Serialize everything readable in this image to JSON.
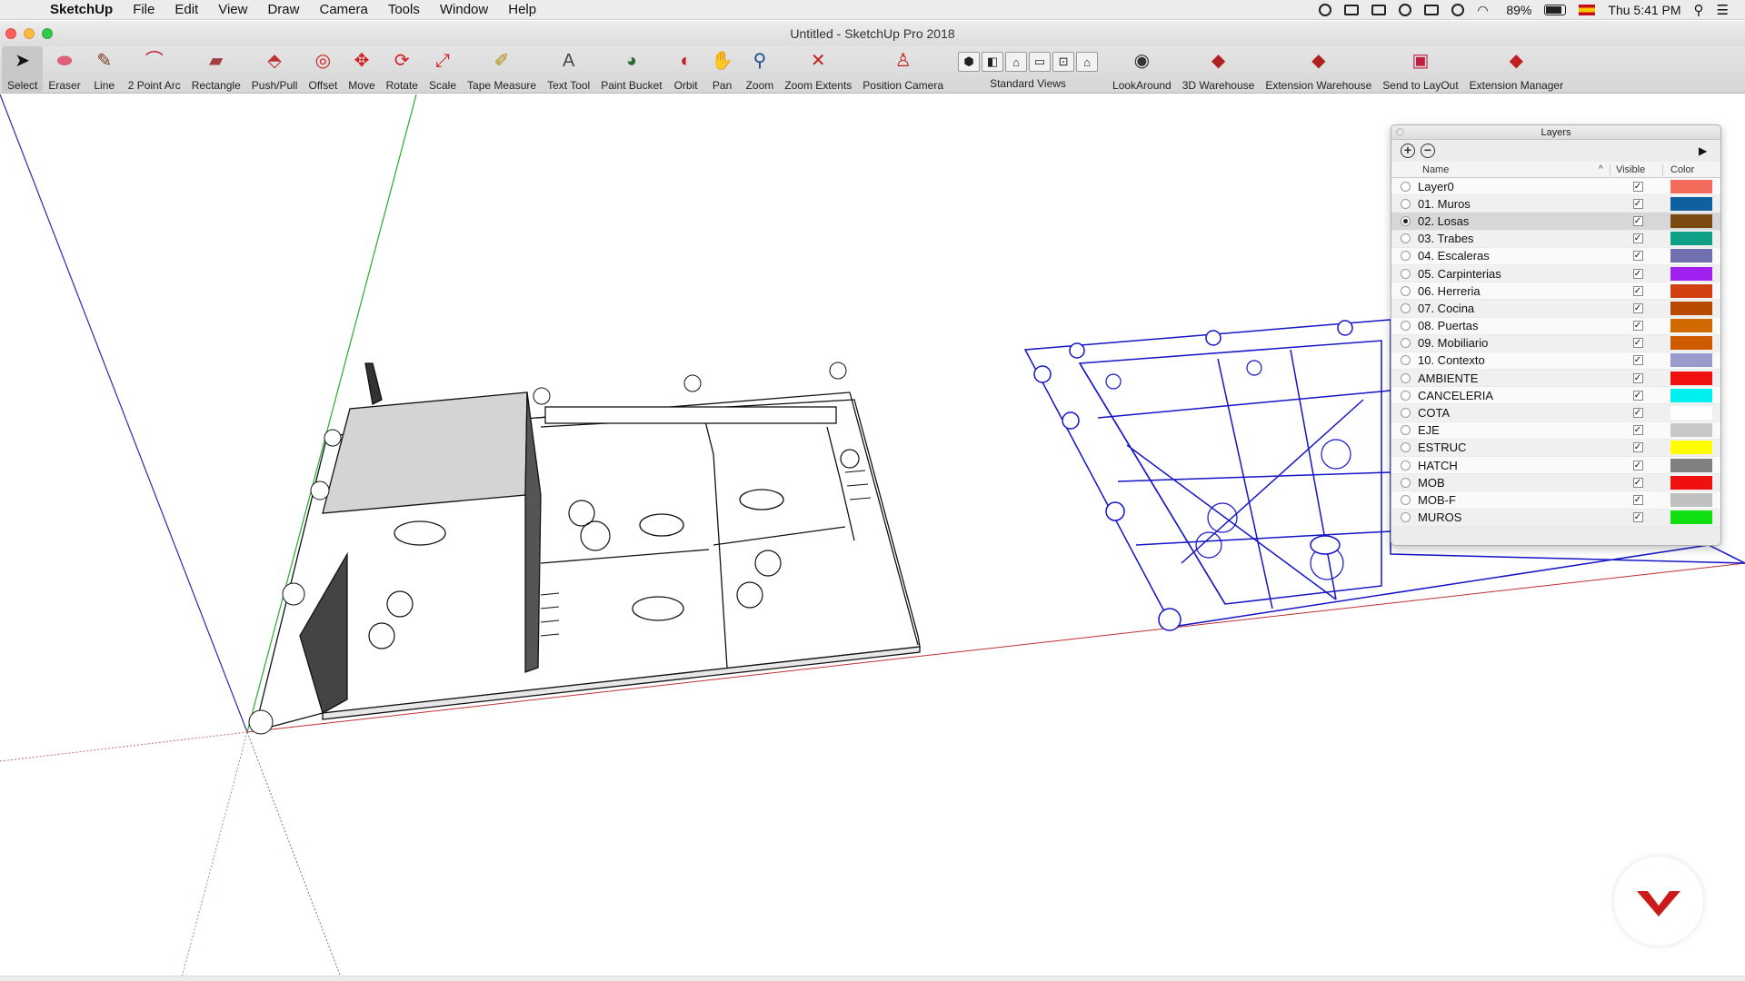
{
  "menubar": {
    "items": [
      "SketchUp",
      "File",
      "Edit",
      "View",
      "Draw",
      "Camera",
      "Tools",
      "Window",
      "Help"
    ],
    "battery": "89%",
    "clock": "Thu 5:41 PM"
  },
  "window": {
    "title": "Untitled - SketchUp Pro 2018"
  },
  "toolbar": {
    "tools": [
      {
        "label": "Select",
        "icon": "select-arrow-icon",
        "glyph": "➤",
        "color": "#111111",
        "active": true
      },
      {
        "label": "Eraser",
        "icon": "eraser-icon",
        "glyph": "⬬",
        "color": "#e0607a"
      },
      {
        "label": "Line",
        "icon": "pencil-icon",
        "glyph": "✎",
        "color": "#7a3b1a"
      },
      {
        "label": "2 Point Arc",
        "icon": "arc-icon",
        "glyph": "⌒",
        "color": "#c02040"
      },
      {
        "label": "Rectangle",
        "icon": "rectangle-icon",
        "glyph": "▰",
        "color": "#a04040"
      },
      {
        "label": "Push/Pull",
        "icon": "push-pull-icon",
        "glyph": "⬘",
        "color": "#c03030"
      },
      {
        "label": "Offset",
        "icon": "offset-icon",
        "glyph": "◎",
        "color": "#d02020"
      },
      {
        "label": "Move",
        "icon": "move-icon",
        "glyph": "✥",
        "color": "#d02020"
      },
      {
        "label": "Rotate",
        "icon": "rotate-icon",
        "glyph": "⟳",
        "color": "#d02020"
      },
      {
        "label": "Scale",
        "icon": "scale-icon",
        "glyph": "⤢",
        "color": "#d02020"
      },
      {
        "label": "Tape Measure",
        "icon": "tape-measure-icon",
        "glyph": "✐",
        "color": "#b08a10"
      },
      {
        "label": "Text Tool",
        "icon": "text-tool-icon",
        "glyph": "A",
        "color": "#444444"
      },
      {
        "label": "Paint Bucket",
        "icon": "paint-bucket-icon",
        "glyph": "◕",
        "color": "#2a6a2a"
      },
      {
        "label": "Orbit",
        "icon": "orbit-icon",
        "glyph": "◐",
        "color": "#c02020"
      },
      {
        "label": "Pan",
        "icon": "pan-hand-icon",
        "glyph": "✋",
        "color": "#d09a50"
      },
      {
        "label": "Zoom",
        "icon": "zoom-icon",
        "glyph": "⚲",
        "color": "#204a90"
      },
      {
        "label": "Zoom Extents",
        "icon": "zoom-extents-icon",
        "glyph": "✕",
        "color": "#c02020"
      },
      {
        "label": "Position Camera",
        "icon": "position-camera-icon",
        "glyph": "♙",
        "color": "#c02020"
      }
    ],
    "standard_views_label": "Standard Views",
    "standard_views": [
      "⬢",
      "◧",
      "⌂",
      "▭",
      "⊡",
      "⌂"
    ],
    "extensions": [
      {
        "label": "LookAround",
        "icon": "lookaround-eye-icon",
        "glyph": "◉",
        "color": "#333333"
      },
      {
        "label": "3D Warehouse",
        "icon": "3d-warehouse-icon",
        "glyph": "◆",
        "color": "#b02020"
      },
      {
        "label": "Extension Warehouse",
        "icon": "extension-warehouse-icon",
        "glyph": "◆",
        "color": "#b02020"
      },
      {
        "label": "Send to LayOut",
        "icon": "send-to-layout-icon",
        "glyph": "▣",
        "color": "#c02040"
      },
      {
        "label": "Extension Manager",
        "icon": "extension-manager-icon",
        "glyph": "◆",
        "color": "#c02020"
      }
    ]
  },
  "layers": {
    "title": "Layers",
    "header": {
      "name": "Name",
      "sort": "^",
      "visible": "Visible",
      "color": "Color"
    },
    "rows": [
      {
        "name": "Layer0",
        "visible": true,
        "color": "#f26b5b",
        "active": false
      },
      {
        "name": "01. Muros",
        "visible": true,
        "color": "#1060a0",
        "active": false
      },
      {
        "name": "02. Losas",
        "visible": true,
        "color": "#7a4a10",
        "active": true
      },
      {
        "name": "03. Trabes",
        "visible": true,
        "color": "#10a088",
        "active": false
      },
      {
        "name": "04. Escaleras",
        "visible": true,
        "color": "#7070b0",
        "active": false
      },
      {
        "name": "05. Carpinterias",
        "visible": true,
        "color": "#a020f0",
        "active": false
      },
      {
        "name": "06. Herreria",
        "visible": true,
        "color": "#d04010",
        "active": false
      },
      {
        "name": "07. Cocina",
        "visible": true,
        "color": "#b84a00",
        "active": false
      },
      {
        "name": "08. Puertas",
        "visible": true,
        "color": "#d06a00",
        "active": false
      },
      {
        "name": "09. Mobiliario",
        "visible": true,
        "color": "#d05a00",
        "active": false
      },
      {
        "name": "10. Contexto",
        "visible": true,
        "color": "#9a9acc",
        "active": false
      },
      {
        "name": "AMBIENTE",
        "visible": true,
        "color": "#f01010",
        "active": false
      },
      {
        "name": "CANCELERIA",
        "visible": true,
        "color": "#00f0f0",
        "active": false
      },
      {
        "name": "COTA",
        "visible": true,
        "color": "#ffffff",
        "active": false
      },
      {
        "name": "EJE",
        "visible": true,
        "color": "#c8c8c8",
        "active": false
      },
      {
        "name": "ESTRUC",
        "visible": true,
        "color": "#ffff00",
        "active": false
      },
      {
        "name": "HATCH",
        "visible": true,
        "color": "#808080",
        "active": false
      },
      {
        "name": "MOB",
        "visible": true,
        "color": "#f01010",
        "active": false
      },
      {
        "name": "MOB-F",
        "visible": true,
        "color": "#c0c0c0",
        "active": false
      },
      {
        "name": "MUROS",
        "visible": true,
        "color": "#10e010",
        "active": false
      }
    ]
  }
}
